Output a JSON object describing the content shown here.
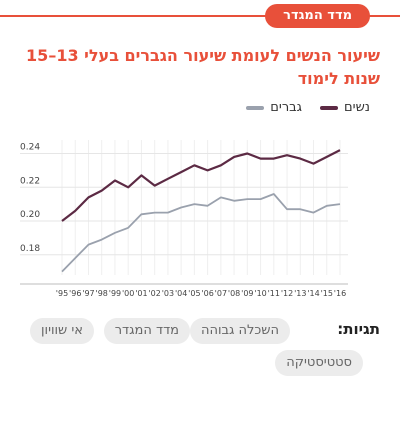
{
  "badge": "מדד המגדר",
  "title_line1": "שיעור הנשים לעומת שיעור הגברים בעלי 13–15",
  "title_line2": "שנות לימוד",
  "legend": {
    "women": "נשים",
    "men": "גברים"
  },
  "colors": {
    "accent": "#e8503a",
    "women": "#5c2a44",
    "men": "#9aa1ad"
  },
  "tags_label": "תגיות:",
  "tags": [
    "השכלה גבוהה",
    "מדד המגדר",
    "אי שוויון",
    "סטטיסטיקה"
  ],
  "chart_data": {
    "type": "line",
    "categories": [
      "'95",
      "'96",
      "'97",
      "'98",
      "'99",
      "'00",
      "'01",
      "'02",
      "'03",
      "'04",
      "'05",
      "'06",
      "'07",
      "'08",
      "'09",
      "'10",
      "'11",
      "'12",
      "'13",
      "'14",
      "'15",
      "'16"
    ],
    "series": [
      {
        "name": "נשים",
        "values": [
          0.2,
          0.206,
          0.214,
          0.218,
          0.224,
          0.22,
          0.227,
          0.221,
          0.225,
          0.229,
          0.233,
          0.23,
          0.233,
          0.238,
          0.24,
          0.237,
          0.237,
          0.239,
          0.237,
          0.234,
          0.238,
          0.242
        ]
      },
      {
        "name": "גברים",
        "values": [
          0.17,
          0.178,
          0.186,
          0.189,
          0.193,
          0.196,
          0.204,
          0.205,
          0.205,
          0.208,
          0.21,
          0.209,
          0.214,
          0.212,
          0.213,
          0.213,
          0.216,
          0.207,
          0.207,
          0.205,
          0.209,
          0.21
        ]
      }
    ],
    "yticks": [
      "0.18",
      "0.20",
      "0.22",
      "0.24"
    ],
    "ylim": [
      0.168,
      0.248
    ],
    "xlabel": "",
    "ylabel": "",
    "grid": true,
    "legend_position": "top-right"
  }
}
